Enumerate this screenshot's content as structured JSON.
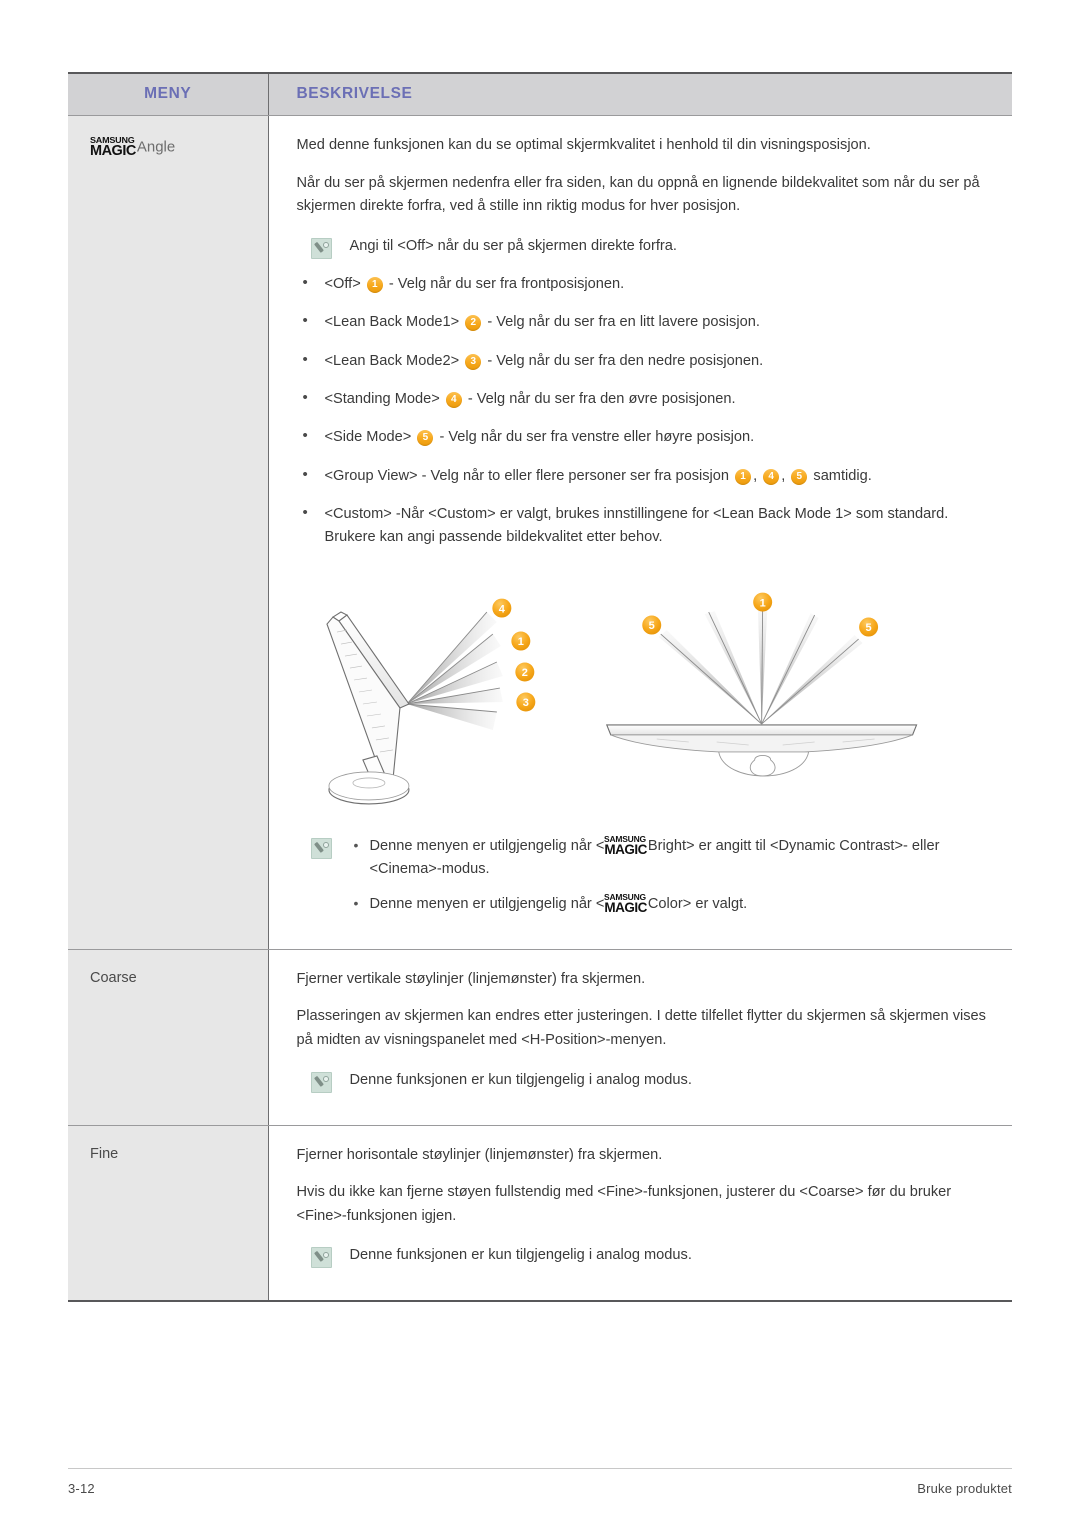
{
  "header": {
    "col_menu": "MENY",
    "col_description": "BESKRIVELSE",
    "header_text_color": "#6b6fb5",
    "header_bg_color": "#d2d2d4"
  },
  "logo": {
    "top": "SAMSUNG",
    "bottom": "MAGIC"
  },
  "rows": [
    {
      "menu_label": "Angle",
      "paragraphs": [
        "Med denne funksjonen kan du se optimal skjermkvalitet i henhold til din visningsposisjon.",
        "Når du ser på skjermen nedenfra eller fra siden, kan du oppnå en lignende bildekvalitet som når du ser på skjermen direkte forfra, ved å stille inn riktig modus for hver posisjon."
      ],
      "note_top": "Angi til <Off> når du ser på skjermen direkte forfra.",
      "options": [
        {
          "name": "<Off>",
          "badge": "1",
          "text": "- Velg når du ser fra frontposisjonen."
        },
        {
          "name": "<Lean Back Mode1>",
          "badge": "2",
          "text": "- Velg når du ser fra en litt lavere posisjon."
        },
        {
          "name": "<Lean Back Mode2>",
          "badge": "3",
          "text": "- Velg når du ser fra den nedre posisjonen."
        },
        {
          "name": "<Standing Mode>",
          "badge": "4",
          "text": "- Velg når du ser fra den øvre posisjonen."
        },
        {
          "name": "<Side Mode>",
          "badge": "5",
          "text": "- Velg når du ser fra venstre eller høyre posisjon."
        }
      ],
      "group_view": {
        "prefix": "<Group View> - Velg når to eller flere personer ser fra posisjon",
        "badges": [
          "1",
          "4",
          "5"
        ],
        "suffix": "samtidig."
      },
      "custom": "<Custom> -Når <Custom> er valgt, brukes innstillingene for <Lean Back Mode 1> som standard. Brukere kan angi passende bildekvalitet etter behov.",
      "bottom_notes": [
        {
          "pre": "Denne menyen er utilgjengelig når <",
          "post": "Bright> er angitt til <Dynamic Contrast>- eller <Cinema>-modus."
        },
        {
          "pre": "Denne menyen er utilgjengelig når <",
          "post": "Color> er valgt."
        }
      ],
      "diagram": {
        "left_labels": [
          "4",
          "1",
          "2",
          "3"
        ],
        "right_labels": [
          "5",
          "1",
          "5"
        ],
        "accent_color": "#f7a81b"
      }
    },
    {
      "menu_label": "Coarse",
      "paragraphs": [
        "Fjerner vertikale støylinjer (linjemønster) fra skjermen.",
        "Plasseringen av skjermen kan endres etter justeringen. I dette tilfellet flytter du skjermen så skjermen vises på midten av visningspanelet med <H-Position>-menyen."
      ],
      "note": "Denne funksjonen er kun tilgjengelig i analog modus."
    },
    {
      "menu_label": "Fine",
      "paragraphs": [
        "Fjerner horisontale støylinjer (linjemønster) fra skjermen.",
        "Hvis du ikke kan fjerne støyen fullstendig med <Fine>-funksjonen, justerer du <Coarse> før du bruker <Fine>-funksjonen igjen."
      ],
      "note": "Denne funksjonen er kun tilgjengelig i analog modus."
    }
  ],
  "footer": {
    "page_number": "3-12",
    "section": "Bruke produktet"
  }
}
